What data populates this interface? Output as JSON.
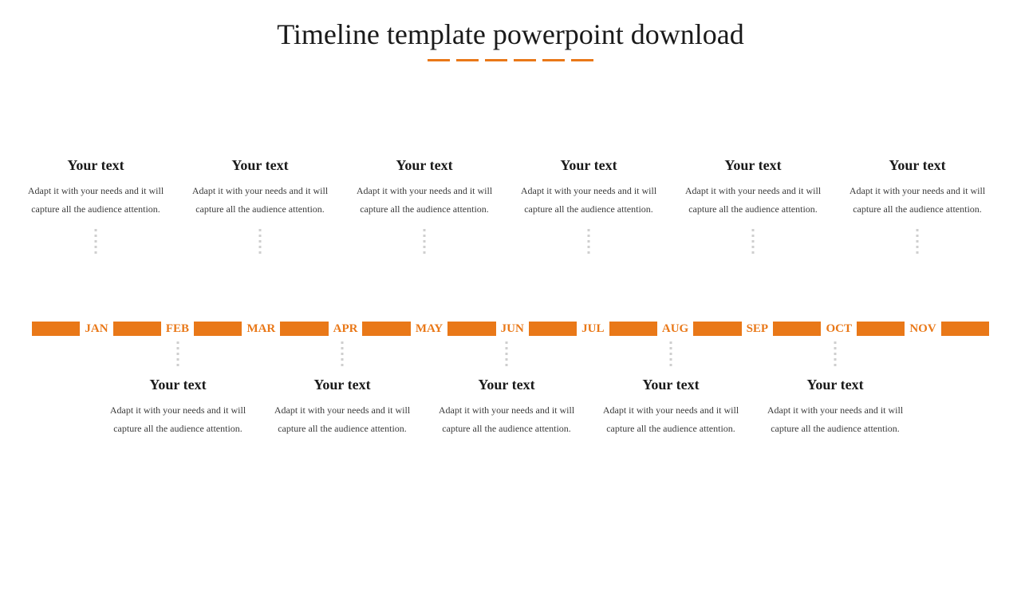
{
  "title": "Timeline template powerpoint download",
  "months": [
    "JAN",
    "FEB",
    "MAR",
    "APR",
    "MAY",
    "JUN",
    "JUL",
    "AUG",
    "SEP",
    "OCT",
    "NOV"
  ],
  "top_items": [
    {
      "heading": "Your text",
      "body": "Adapt it with your needs and it will capture all the audience attention."
    },
    {
      "heading": "Your text",
      "body": "Adapt it with your needs and it will capture all the audience attention."
    },
    {
      "heading": "Your text",
      "body": "Adapt it with your needs and it will capture all the audience attention."
    },
    {
      "heading": "Your text",
      "body": "Adapt it with your needs and it will capture all the audience attention."
    },
    {
      "heading": "Your text",
      "body": "Adapt it with your needs and it will capture all the audience attention."
    },
    {
      "heading": "Your text",
      "body": "Adapt it with your needs and it will capture all the audience attention."
    }
  ],
  "bottom_items": [
    {
      "heading": "Your text",
      "body": "Adapt it with your needs and it will capture all the audience attention."
    },
    {
      "heading": "Your text",
      "body": "Adapt it with your needs and it will capture all the audience attention."
    },
    {
      "heading": "Your text",
      "body": "Adapt it with your needs and it will capture all the audience attention."
    },
    {
      "heading": "Your text",
      "body": "Adapt it with your needs and it will capture all the audience attention."
    },
    {
      "heading": "Your text",
      "body": "Adapt it with your needs and it will capture all the audience attention."
    }
  ],
  "colors": {
    "accent": "#e97818"
  }
}
